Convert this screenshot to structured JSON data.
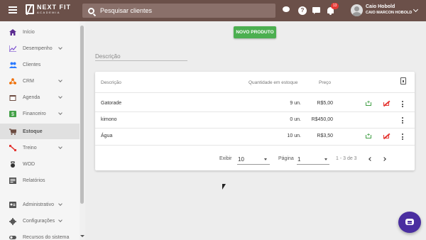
{
  "app": {
    "logo_name": "NEXT FIT",
    "logo_sub": "ACADEMIA"
  },
  "header": {
    "search_placeholder": "Pesquisar clientes",
    "help_symbol": "?",
    "notification_count": "13",
    "user_name": "Caio Hobold",
    "user_subtitle": "CAIO MARCON HOBOLD"
  },
  "sidebar": {
    "items": [
      {
        "label": "Início",
        "icon": "home-icon",
        "color": "#5c2d91"
      },
      {
        "label": "Desempenho",
        "icon": "trending-icon",
        "color": "#7b4fd0"
      },
      {
        "label": "Clientes",
        "icon": "people-icon",
        "color": "#2979ff"
      },
      {
        "label": "CRM",
        "icon": "crm-icon",
        "color": "#ef6c00"
      },
      {
        "label": "Agenda",
        "icon": "calendar-icon",
        "color": "#6d4c41"
      },
      {
        "label": "Financeiro",
        "icon": "money-icon",
        "color": "#43a047"
      },
      {
        "label": "Estoque",
        "icon": "cart-icon",
        "color": "#6d4c41"
      },
      {
        "label": "Treino",
        "icon": "dumbbell-icon",
        "color": "#e53935"
      },
      {
        "label": "WOD",
        "icon": "kettlebell-icon",
        "color": "#333333"
      },
      {
        "label": "Relatórios",
        "icon": "report-icon",
        "color": "#555555"
      },
      {
        "label": "Administrativo",
        "icon": "admin-icon",
        "color": "#555555"
      },
      {
        "label": "Configurações",
        "icon": "gear-icon",
        "color": "#555555"
      },
      {
        "label": "Recursos do sistema",
        "icon": "toggle-icon",
        "color": "#555555"
      }
    ]
  },
  "toolbar": {
    "new_product_label": "NOVO PRODUTO",
    "filter_label": "Descrição"
  },
  "table": {
    "columns": {
      "description": "Descrição",
      "quantity": "Quantidade em estoque",
      "price": "Preço"
    },
    "rows": [
      {
        "description": "Gatorade",
        "quantity": "9 un.",
        "price": "R$5,00",
        "cart_actions": true
      },
      {
        "description": "kimono",
        "quantity": "0 un.",
        "price": "R$450,00",
        "cart_actions": false
      },
      {
        "description": "Água",
        "quantity": "10 un.",
        "price": "R$3,50",
        "cart_actions": true
      }
    ]
  },
  "pagination": {
    "show_label": "Exibir",
    "show_value": "10",
    "page_label": "Página",
    "page_value": "1",
    "range": "1 - 3 de 3"
  },
  "colors": {
    "topbar": "#6b5049",
    "primary_button": "#4caf50",
    "add_stock": "#43a047",
    "remove_stock": "#e53935",
    "chat_fab": "#4a2ea0"
  }
}
